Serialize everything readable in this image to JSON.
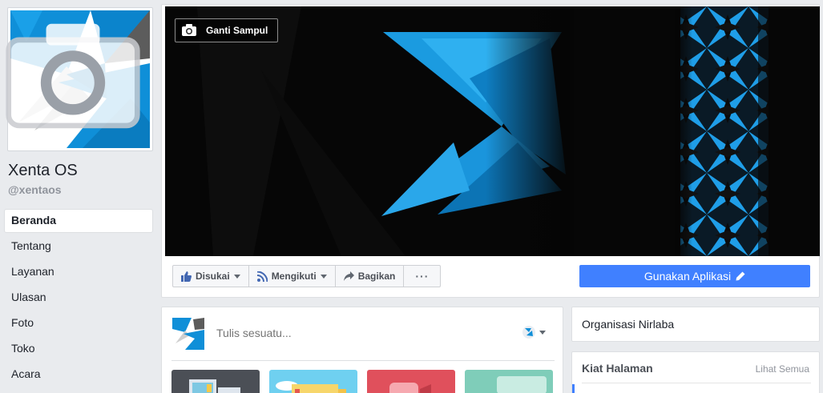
{
  "page": {
    "name": "Xenta OS",
    "handle": "@xentaos"
  },
  "nav": {
    "items": [
      {
        "label": "Beranda",
        "active": true
      },
      {
        "label": "Tentang"
      },
      {
        "label": "Layanan"
      },
      {
        "label": "Ulasan"
      },
      {
        "label": "Foto"
      },
      {
        "label": "Toko"
      },
      {
        "label": "Acara"
      }
    ]
  },
  "cover": {
    "change_cover_label": "Ganti Sampul"
  },
  "actions": {
    "liked_label": "Disukai",
    "following_label": "Mengikuti",
    "share_label": "Bagikan",
    "more_label": "···",
    "use_app_label": "Gunakan Aplikasi"
  },
  "composer": {
    "placeholder": "Tulis sesuatu..."
  },
  "sidebar": {
    "category": "Organisasi Nirlaba",
    "page_likes_title": "Kiat Halaman",
    "see_all_label": "Lihat Semua"
  },
  "colors": {
    "brand_blue": "#0f8fd8",
    "button_blue": "#4080ff",
    "page_bg": "#e9ebee"
  }
}
